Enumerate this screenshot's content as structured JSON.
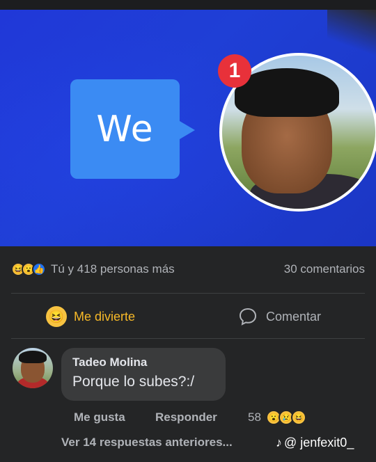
{
  "post": {
    "image": {
      "bubble_text": "We",
      "notification_count": "1"
    },
    "stats": {
      "reactions_text": "Tú y 418 personas más",
      "comments_text": "30 comentarios",
      "reaction_icons": [
        "haha-icon",
        "wow-icon",
        "like-icon"
      ]
    },
    "actions": {
      "react_label": "Me divierte",
      "comment_label": "Comentar"
    }
  },
  "comment": {
    "author": "Tadeo Molina",
    "text": "Porque lo subes?:/",
    "like_label": "Me gusta",
    "reply_label": "Responder",
    "reaction_count": "58",
    "reaction_icons": [
      "wow-icon",
      "sad-icon",
      "haha-icon"
    ]
  },
  "replies": {
    "link_text": "Ver 14 respuestas anteriores..."
  },
  "watermark": {
    "text": "@ jenfexit0_"
  },
  "colors": {
    "background": "#242526",
    "accent_react": "#f7b928",
    "like_blue": "#1f72f2",
    "badge_red": "#e8313a",
    "bubble_blue": "#3b8bf3"
  }
}
